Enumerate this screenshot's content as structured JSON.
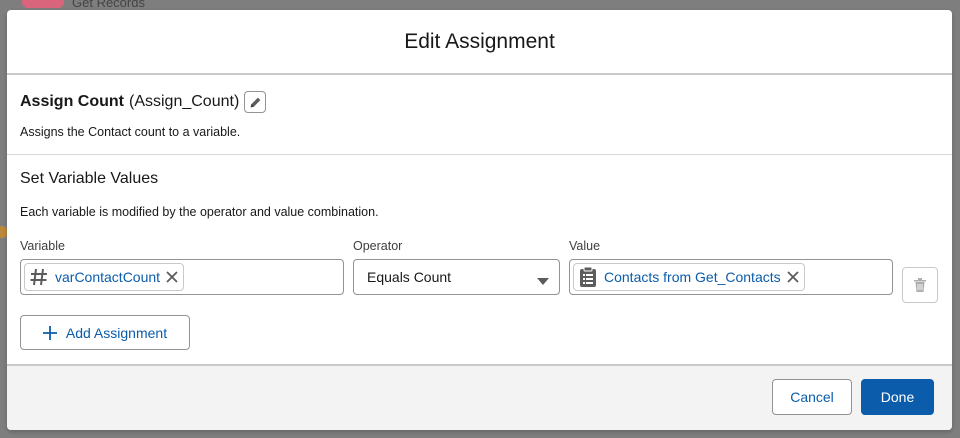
{
  "background": {
    "node_label": "Get Records"
  },
  "modal": {
    "title": "Edit Assignment"
  },
  "element": {
    "name": "Assign Count",
    "api_name": "(Assign_Count)",
    "description": "Assigns the Contact count to a variable."
  },
  "variables_section": {
    "title": "Set Variable Values",
    "description": "Each variable is modified by the operator and value combination."
  },
  "assignment": {
    "variable_label": "Variable",
    "variable_value": "varContactCount",
    "variable_icon": "number-icon",
    "operator_label": "Operator",
    "operator_value": "Equals Count",
    "value_label": "Value",
    "value_value": "Contacts from Get_Contacts",
    "value_icon": "record-collection-icon"
  },
  "add_assignment_label": "Add Assignment",
  "footer": {
    "cancel_label": "Cancel",
    "done_label": "Done"
  },
  "colors": {
    "brand": "#0b5cab",
    "border": "#939393",
    "footer_bg": "#f3f3f3"
  }
}
